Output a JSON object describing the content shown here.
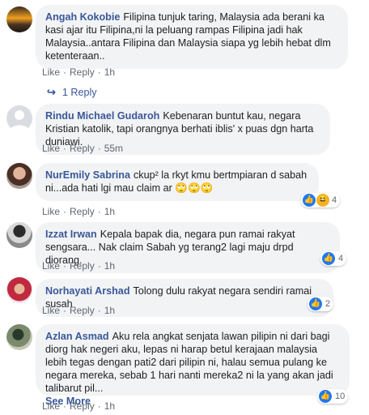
{
  "comments": [
    {
      "name": "Angah Kokobie",
      "text": "Filipina tunjuk taring, Malaysia ada berani ka kasi ajar itu Filipina,ni la peluang rampas Filipina jadi hak Malaysia..antara Filipina dan Malaysia siapa yg lebih hebat dlm ketenteraan..",
      "like": "Like",
      "reply": "Reply",
      "time": "1h",
      "replies": "1 Reply"
    },
    {
      "name": "Rindu Michael Gudaroh",
      "text": "Kebenaran buntut kau, negara Kristian katolik, tapi orangnya berhati iblis' x puas dgn harta duniawi.",
      "like": "Like",
      "reply": "Reply",
      "time": "55m"
    },
    {
      "name": "NurEmily Sabrina",
      "text": "ckup² la rkyt kmu bertmpiaran d sabah ni...ada hati lgi mau claim ar 🙄🙄🙄",
      "like": "Like",
      "reply": "Reply",
      "time": "1h",
      "reaction_count": "4"
    },
    {
      "name": "Izzat Irwan",
      "text": "Kepala bapak dia, negara pun ramai rakyat sengsara... Nak claim Sabah yg terang2 lagi maju drpd diorang.",
      "like": "Like",
      "reply": "Reply",
      "time": "1h",
      "reaction_count": "4"
    },
    {
      "name": "Norhayati Arshad",
      "text": "Tolong dulu rakyat negara sendiri ramai susah",
      "like": "Like",
      "reply": "Reply",
      "time": "1h",
      "reaction_count": "2"
    },
    {
      "name": "Azlan Asmad",
      "text": "Aku rela angkat senjata lawan pilipin ni dari bagi diorg hak negeri aku, lepas ni harap betul kerajaan malaysia lebih tegas dengan pati2 dari pilipin ni, halau semua pulang ke negara mereka, sebab 1 hari nanti mereka2 ni la yang akan jadi talibarut pil...",
      "see_more": "See More",
      "like": "Like",
      "reply": "Reply",
      "time": "1h",
      "reaction_count": "10"
    }
  ],
  "colors": {
    "name": "#385898",
    "bubble": "#f2f3f5",
    "like": "#2078f4"
  }
}
